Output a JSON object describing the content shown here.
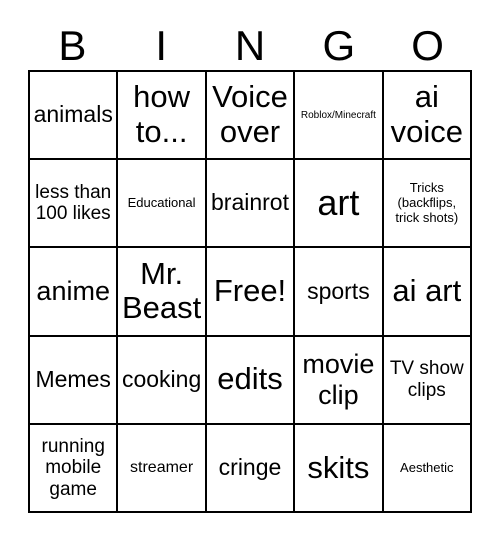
{
  "header": {
    "letters": [
      "B",
      "I",
      "N",
      "G",
      "O"
    ]
  },
  "grid": {
    "rows": 5,
    "columns": 5,
    "free_space_label": "Free!",
    "cells": [
      {
        "text": "animals",
        "size": "md"
      },
      {
        "text": "how to...",
        "size": "xl"
      },
      {
        "text": "Voice over",
        "size": "xl"
      },
      {
        "text": "Roblox/Minecraft",
        "size": "tiny"
      },
      {
        "text": "ai voice",
        "size": "xl"
      },
      {
        "text": "less than 100 likes",
        "size": "sm"
      },
      {
        "text": "Educational",
        "size": "xxs"
      },
      {
        "text": "brainrot",
        "size": "md"
      },
      {
        "text": "art",
        "size": "xxl"
      },
      {
        "text": "Tricks (backflips, trick shots)",
        "size": "xxs"
      },
      {
        "text": "anime",
        "size": "lg"
      },
      {
        "text": "Mr. Beast",
        "size": "xl"
      },
      {
        "text": "Free!",
        "size": "xl"
      },
      {
        "text": "sports",
        "size": "md"
      },
      {
        "text": "ai art",
        "size": "xl"
      },
      {
        "text": "Memes",
        "size": "md"
      },
      {
        "text": "cooking",
        "size": "md"
      },
      {
        "text": "edits",
        "size": "xl"
      },
      {
        "text": "movie clip",
        "size": "lg"
      },
      {
        "text": "TV show clips",
        "size": "sm"
      },
      {
        "text": "running mobile game",
        "size": "sm"
      },
      {
        "text": "streamer",
        "size": "xs"
      },
      {
        "text": "cringe",
        "size": "md"
      },
      {
        "text": "skits",
        "size": "xl"
      },
      {
        "text": "Aesthetic",
        "size": "xxs"
      }
    ]
  },
  "colors": {
    "background": "#ffffff",
    "text": "#000000",
    "border": "#000000"
  }
}
